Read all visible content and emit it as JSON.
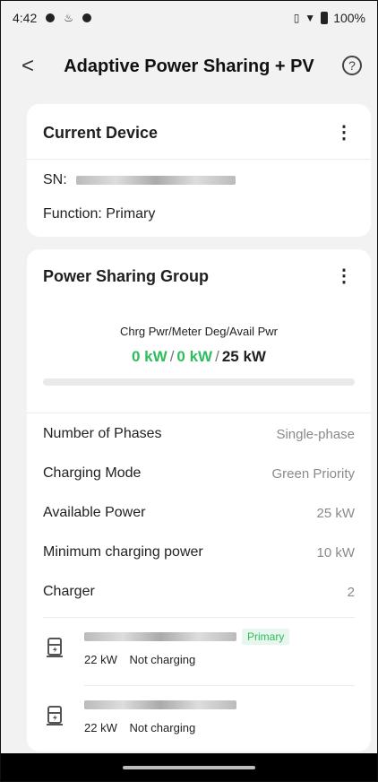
{
  "status_bar": {
    "time": "4:42",
    "battery": "100%"
  },
  "header": {
    "title": "Adaptive Power Sharing + PV"
  },
  "current_device": {
    "title": "Current Device",
    "sn_label": "SN:",
    "function_text": "Function: Primary"
  },
  "group": {
    "title": "Power Sharing Group",
    "power_label": "Chrg Pwr/Meter Deg/Avail Pwr",
    "charging_power": "0 kW",
    "meter_degree": "0 kW",
    "available_power": "25 kW",
    "slash": "/",
    "progress": 0,
    "rows": [
      {
        "key": "Number of Phases",
        "value": "Single-phase"
      },
      {
        "key": "Charging Mode",
        "value": "Green Priority"
      },
      {
        "key": "Available Power",
        "value": "25 kW"
      },
      {
        "key": "Minimum charging power",
        "value": "10 kW"
      },
      {
        "key": "Charger",
        "value": "2"
      }
    ],
    "chargers": [
      {
        "badge": "Primary",
        "power": "22 kW",
        "status": "Not charging"
      },
      {
        "badge": "",
        "power": "22 kW",
        "status": "Not charging"
      }
    ]
  },
  "colors": {
    "accent_green": "#2ebd5c",
    "background": "#f2f2f2"
  },
  "icons": {
    "back": "chevron-left-icon",
    "help": "help-circle-icon",
    "more": "more-vertical-icon",
    "charger": "ev-charger-icon"
  }
}
